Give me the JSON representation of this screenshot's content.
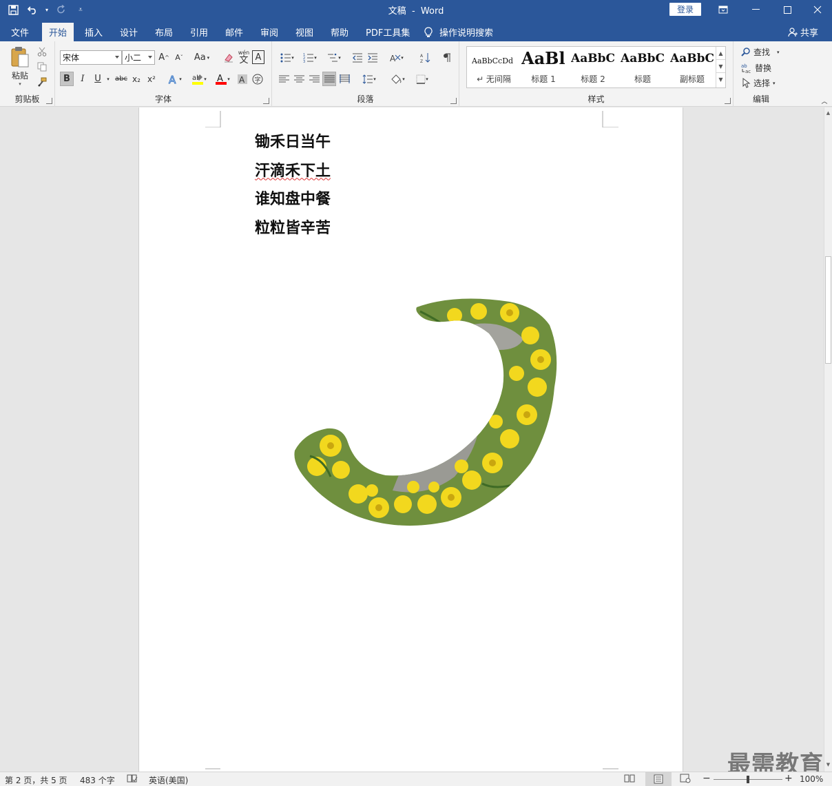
{
  "app": {
    "doc_name": "文稿",
    "app_name": "Word",
    "title_sep": "-"
  },
  "login_label": "登录",
  "tabs": [
    "文件",
    "开始",
    "插入",
    "设计",
    "布局",
    "引用",
    "邮件",
    "审阅",
    "视图",
    "帮助",
    "PDF工具集"
  ],
  "tell_me": "操作说明搜索",
  "share_label": "共享",
  "groups": {
    "clipboard": "剪贴板",
    "font": "字体",
    "paragraph": "段落",
    "styles": "样式",
    "editing": "编辑"
  },
  "clipboard": {
    "paste_label": "粘贴"
  },
  "font": {
    "name": "宋体",
    "size": "小二",
    "grow": "A",
    "shrink": "A",
    "case": "Aa",
    "phonetic": "wén",
    "bold": "B",
    "italic": "I",
    "underline": "U",
    "strike": "abc",
    "sub": "x₂",
    "sup": "x²"
  },
  "styles": [
    {
      "preview": "AaBbCcDd",
      "name": "↵ 无间隔"
    },
    {
      "preview": "AaBl",
      "name": "标题 1"
    },
    {
      "preview": "AaBbC",
      "name": "标题 2"
    },
    {
      "preview": "AaBbC",
      "name": "标题"
    },
    {
      "preview": "AaBbC",
      "name": "副标题"
    }
  ],
  "editing": {
    "find": "查找",
    "replace": "替换",
    "select": "选择"
  },
  "poem": [
    "锄禾日当午",
    "汗滴禾下土",
    "谁知盘中餐",
    "粒粒皆辛苦"
  ],
  "status": {
    "page": "第 2 页，共 5 页",
    "words": "483 个字",
    "language": "英语(美国)",
    "zoom": "100%",
    "zoom_level": 1.0
  },
  "watermark": "最需教育",
  "colors": {
    "accent": "#2b579a",
    "highlight": "#ffff00",
    "font_color": "#ff0000"
  }
}
